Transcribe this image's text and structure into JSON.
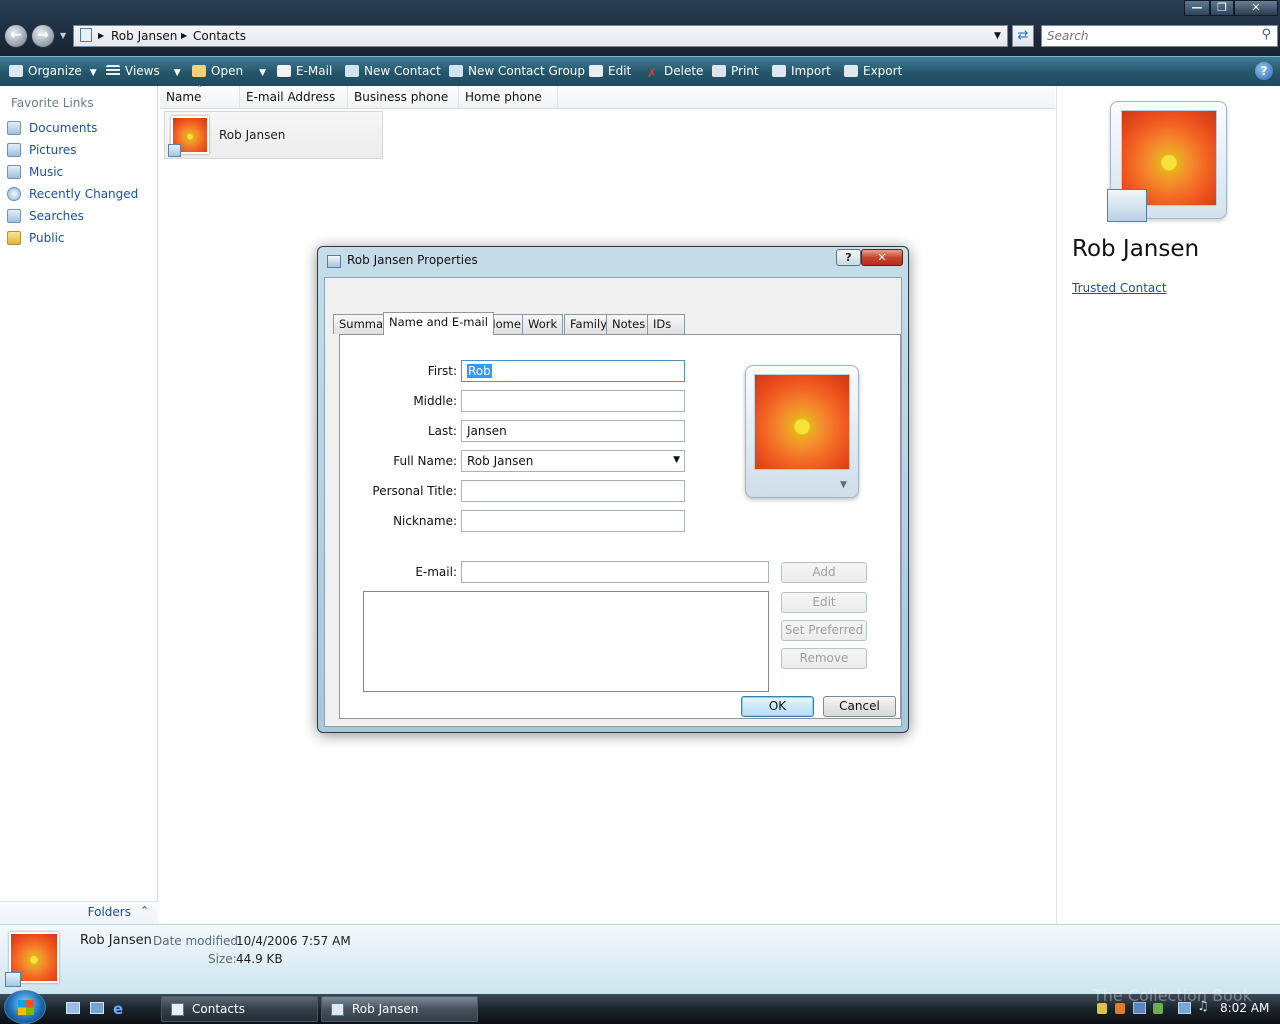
{
  "window": {
    "breadcrumbs": [
      "Rob Jansen",
      "Contacts"
    ],
    "search_placeholder": "Search"
  },
  "toolbar": {
    "organize": "Organize",
    "views": "Views",
    "open": "Open",
    "email": "E-Mail",
    "new_contact": "New Contact",
    "new_contact_group": "New Contact Group",
    "edit": "Edit",
    "delete": "Delete",
    "print": "Print",
    "import": "Import",
    "export": "Export"
  },
  "nav": {
    "header": "Favorite Links",
    "items": [
      "Documents",
      "Pictures",
      "Music",
      "Recently Changed",
      "Searches",
      "Public"
    ],
    "folders": "Folders"
  },
  "columns": [
    "Name",
    "E-mail Address",
    "Business phone",
    "Home phone"
  ],
  "contacts": [
    {
      "name": "Rob Jansen"
    }
  ],
  "preview": {
    "name": "Rob Jansen",
    "link": "Trusted Contact"
  },
  "details": {
    "name": "Rob Jansen",
    "date_label": "Date modified:",
    "date_value": "10/4/2006 7:57 AM",
    "size_label": "Size:",
    "size_value": "44.9 KB"
  },
  "dialog": {
    "title": "Rob Jansen Properties",
    "tabs": [
      "Summary",
      "Name and E-mail",
      "Home",
      "Work",
      "Family",
      "Notes",
      "IDs"
    ],
    "fields": {
      "first_label": "First:",
      "first_value": "Rob",
      "middle_label": "Middle:",
      "middle_value": "",
      "last_label": "Last:",
      "last_value": "Jansen",
      "fullname_label": "Full Name:",
      "fullname_value": "Rob Jansen",
      "title_label": "Personal Title:",
      "title_value": "",
      "nickname_label": "Nickname:",
      "nickname_value": "",
      "email_label": "E-mail:",
      "email_value": ""
    },
    "buttons": {
      "add": "Add",
      "edit": "Edit",
      "set_preferred": "Set Preferred",
      "remove": "Remove",
      "ok": "OK",
      "cancel": "Cancel"
    }
  },
  "taskbar": {
    "tasks": [
      "Contacts",
      "Rob Jansen Properties"
    ],
    "clock": "8:02 AM",
    "watermark": "The Collection Book"
  }
}
